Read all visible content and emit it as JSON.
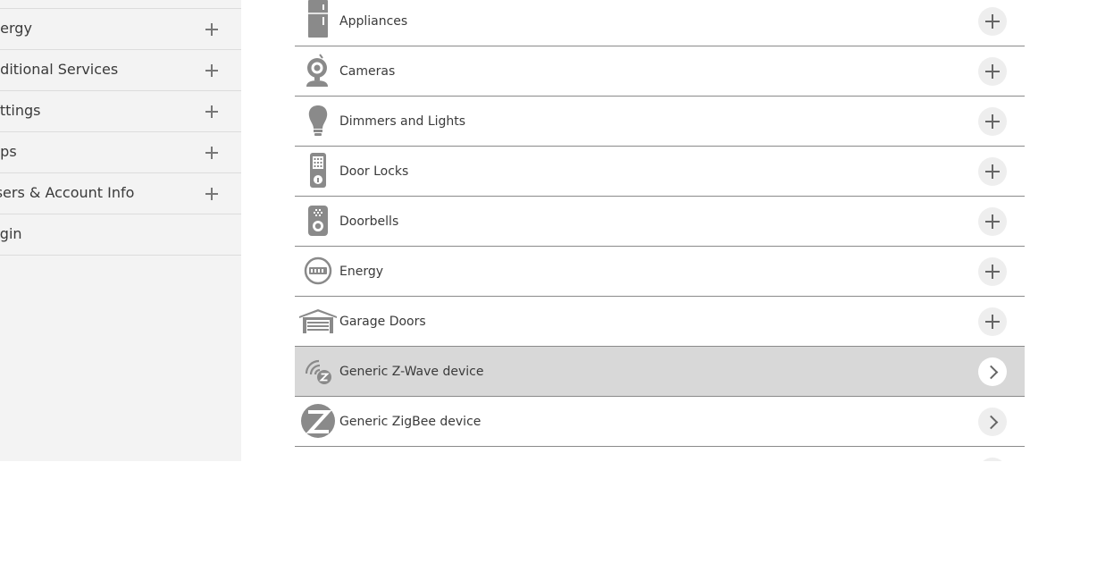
{
  "sidebar": {
    "items": [
      {
        "label": "nergy",
        "expandable": true
      },
      {
        "label": "dditional Services",
        "expandable": true
      },
      {
        "label": "ettings",
        "expandable": true
      },
      {
        "label": "pps",
        "expandable": true
      },
      {
        "label": "Jsers & Account Info",
        "expandable": true
      },
      {
        "label": "ogin",
        "expandable": false
      }
    ],
    "expand_icon": "plus-icon"
  },
  "devices": {
    "items": [
      {
        "label": "Appliances",
        "icon": "refrigerator-icon",
        "action": "expand"
      },
      {
        "label": "Cameras",
        "icon": "camera-icon",
        "action": "expand"
      },
      {
        "label": "Dimmers and Lights",
        "icon": "light-bulb-icon",
        "action": "expand"
      },
      {
        "label": "Door Locks",
        "icon": "door-lock-icon",
        "action": "expand"
      },
      {
        "label": "Doorbells",
        "icon": "doorbell-icon",
        "action": "expand"
      },
      {
        "label": "Energy",
        "icon": "energy-meter-icon",
        "action": "expand"
      },
      {
        "label": "Garage Doors",
        "icon": "garage-icon",
        "action": "expand"
      },
      {
        "label": "Generic Z-Wave device",
        "icon": "zwave-icon",
        "action": "navigate",
        "selected": true
      },
      {
        "label": "Generic ZigBee device",
        "icon": "zigbee-icon",
        "action": "navigate"
      }
    ]
  },
  "colors": {
    "sidebar_bg": "#f3f3f3",
    "selected_row_bg": "#d8d8d8",
    "icon_gray": "#8a8a8a",
    "divider": "#8a8a8a"
  }
}
